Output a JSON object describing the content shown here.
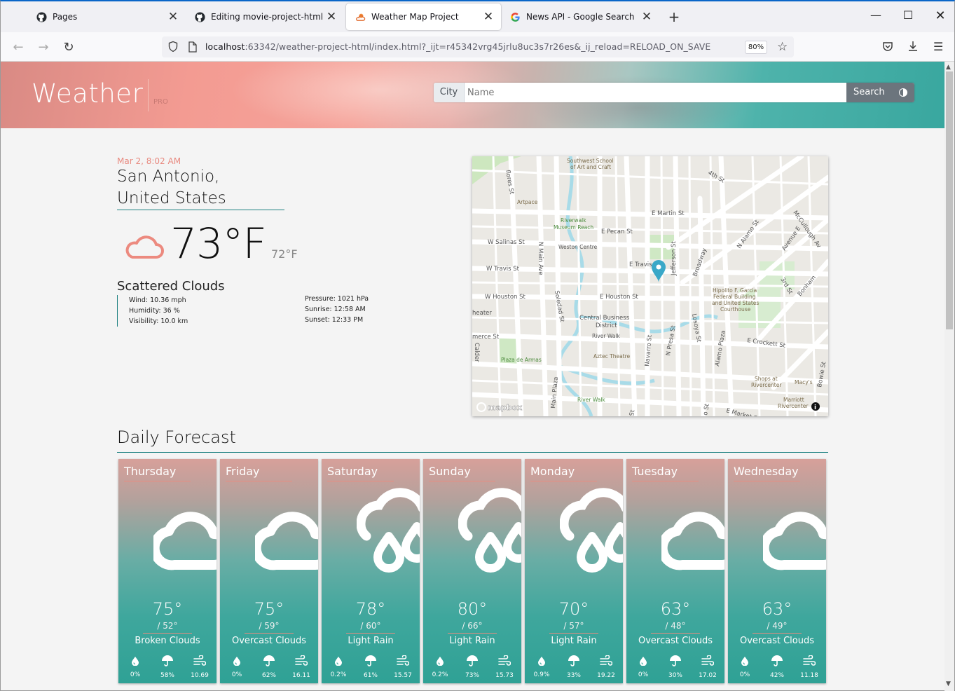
{
  "browser": {
    "tabs": [
      {
        "label": "Pages",
        "icon": "github-icon"
      },
      {
        "label": "Editing movie-project-html/README",
        "icon": "github-icon"
      },
      {
        "label": "Weather Map Project",
        "icon": "weather-icon"
      },
      {
        "label": "News API - Google Search",
        "icon": "google-icon"
      }
    ],
    "new_tab": "+",
    "url_host": "localhost",
    "url_rest": ":63342/weather-project-html/index.html?_ijt=r45342vrg45jrlu8uc3s7r26es&_ij_reload=RELOAD_ON_SAVE",
    "zoom": "80%"
  },
  "header": {
    "logo": "Weather",
    "logo_sub": "PRO",
    "city_label": "City",
    "city_placeholder": "Name",
    "search_label": "Search"
  },
  "current": {
    "datetime": "Mar 2, 8:02 AM",
    "city_line1": "San Antonio,",
    "city_line2": "United States",
    "temp": "73°F",
    "feels_like": "72°F",
    "condition": "Scattered Clouds",
    "wind": "Wind: 10.36 mph",
    "humidity": "Humidity: 36 %",
    "visibility": "Visibility: 10.0 km",
    "pressure": "Pressure: 1021 hPa",
    "sunrise": "Sunrise: 12:58 AM",
    "sunset": "Sunset: 12:33 PM"
  },
  "map": {
    "attribution": "mapbox",
    "labels": [
      "Southwest School of Art and Craft",
      "4th St",
      "Artpace",
      "E Martin St",
      "Riverwalk Museum Reach",
      "E Pecan St",
      "W Salinas St",
      "Weston Centre",
      "N Main Ave",
      "N Alamo St",
      "Avenue E",
      "McCullough Av",
      "W Travis St",
      "E Travis St",
      "Jefferson St",
      "Broadway",
      "3rd St",
      "W Houston St",
      "E Houston St",
      "Soledad St",
      "Hipolito F. Garcia Federal Building and United States Courthouse",
      "Bonham",
      "Central Business District",
      "River Walk",
      "Losoya St",
      "heater",
      "merce St",
      "E Crockett St",
      "Aztec Theatre",
      "Plaza de Armas",
      "Navarro St",
      "N Presa St",
      "Alamo Plaza",
      "Shops at Rivercenter",
      "Macy's",
      "Bowie St",
      "Main Plaza",
      "Marriott Rivercenter",
      "E Market St",
      "Calder",
      "flores St",
      "St"
    ]
  },
  "forecast": {
    "title": "Daily Forecast",
    "days": [
      {
        "day": "Thursday",
        "hi": "75°",
        "lo": "/ 52°",
        "cond": "Broken Clouds",
        "icon": "cloud-icon",
        "precip": "0%",
        "rain": "58%",
        "wind": "10.69"
      },
      {
        "day": "Friday",
        "hi": "75°",
        "lo": "/ 59°",
        "cond": "Overcast Clouds",
        "icon": "cloud-icon",
        "precip": "0%",
        "rain": "62%",
        "wind": "16.11"
      },
      {
        "day": "Saturday",
        "hi": "78°",
        "lo": "/ 60°",
        "cond": "Light Rain",
        "icon": "rain-icon",
        "precip": "0.2%",
        "rain": "61%",
        "wind": "15.57"
      },
      {
        "day": "Sunday",
        "hi": "80°",
        "lo": "/ 66°",
        "cond": "Light Rain",
        "icon": "rain-icon",
        "precip": "0.2%",
        "rain": "73%",
        "wind": "15.73"
      },
      {
        "day": "Monday",
        "hi": "70°",
        "lo": "/ 57°",
        "cond": "Light Rain",
        "icon": "rain-icon",
        "precip": "0.9%",
        "rain": "33%",
        "wind": "19.22"
      },
      {
        "day": "Tuesday",
        "hi": "63°",
        "lo": "/ 48°",
        "cond": "Overcast Clouds",
        "icon": "cloud-icon",
        "precip": "0%",
        "rain": "30%",
        "wind": "17.02"
      },
      {
        "day": "Wednesday",
        "hi": "63°",
        "lo": "/ 49°",
        "cond": "Overcast Clouds",
        "icon": "cloud-icon",
        "precip": "0%",
        "rain": "42%",
        "wind": "11.18"
      }
    ]
  },
  "colors": {
    "accent": "#1c8080",
    "coral": "#e88a80",
    "card_top": "#d7a09a",
    "card_bottom": "#2fa195"
  }
}
